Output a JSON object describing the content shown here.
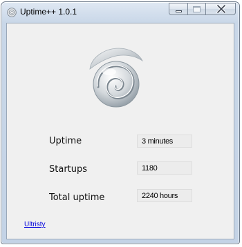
{
  "window": {
    "title": "Uptime++ 1.0.1"
  },
  "caption_buttons": {
    "minimize_icon": "minimize-icon",
    "maximize_icon": "maximize-icon",
    "close_icon": "close-icon"
  },
  "stats": [
    {
      "label": "Uptime",
      "value": "3 minutes"
    },
    {
      "label": "Startups",
      "value": "1180"
    },
    {
      "label": "Total uptime",
      "value": "2240 hours"
    }
  ],
  "footer": {
    "link_text": "Ultristy"
  },
  "colors": {
    "link": "#0000dd",
    "client_background": "#f0f0f0",
    "value_background": "#ececec"
  }
}
